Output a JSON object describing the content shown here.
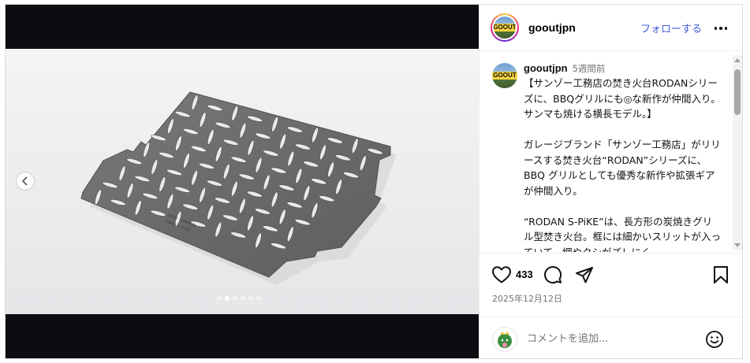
{
  "post": {
    "username": "gooutjpn",
    "follow_label": "フォローする",
    "avatar_logo": "GOOUT",
    "caption": {
      "time_ago": "5週間前",
      "paragraph1": "【サンゾー工務店の焚き火台RODANシリーズに、BBQグリルにも◎な新作が仲間入り。サンマも焼ける横長モデル。】",
      "paragraph2": "ガレージブランド「サンゾー工務店」がリリースする焚き火台“RODAN”シリーズに、BBQ グリルとしても優秀な新作や拡張ギアが仲間入り。",
      "paragraph3": "“RODAN S-PiKE”は、長方形の炭焼きグリル型焚き火台。框には細かいスリットが入っていて、網やクシがズレにく"
    },
    "likes": "433",
    "date": "2025年12月12日",
    "comment_placeholder": "コメントを追加...",
    "carousel": {
      "current_index": 1,
      "total": 6
    }
  },
  "icons": {
    "prev": "chevron-left-icon",
    "more": "more-horizontal-icon",
    "like": "heart-icon",
    "comment": "comment-bubble-icon",
    "share": "paper-plane-icon",
    "save": "bookmark-icon",
    "emoji": "smiley-icon"
  },
  "colors": {
    "link": "#3f5bd8",
    "secondary_text": "#737373",
    "media_bg": "#0b0d10"
  }
}
